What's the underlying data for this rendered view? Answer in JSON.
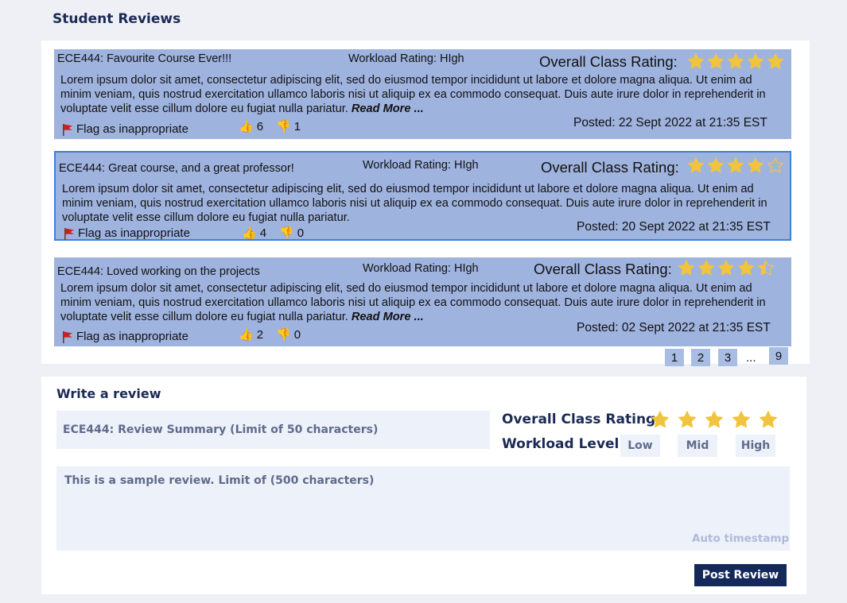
{
  "section_title": "Student Reviews",
  "colors": {
    "card_bg": "#9fb3df",
    "selected_border": "#3a82dc",
    "star": "#f0c43c",
    "heading": "#1b2a55",
    "button_bg": "#14285a"
  },
  "reviews": [
    {
      "title": "ECE444: Favourite Course Ever!!!",
      "workload": "Workload Rating: HIgh",
      "rating_label": "Overall Class Rating:",
      "rating": 5,
      "body": "Lorem ipsum dolor sit amet, consectetur adipiscing elit, sed do eiusmod tempor incididunt ut labore et dolore magna aliqua. Ut enim ad minim veniam, quis nostrud exercitation ullamco laboris nisi ut aliquip ex ea commodo consequat. Duis aute irure dolor in reprehenderit in voluptate velit esse cillum dolore eu fugiat nulla pariatur.",
      "read_more": "Read More ...",
      "flag_label": "Flag as inappropriate",
      "thumbs_up": "6",
      "thumbs_down": "1",
      "posted": "Posted: 22 Sept 2022 at 21:35 EST"
    },
    {
      "title": "ECE444: Great course, and a great professor!",
      "workload": "Workload Rating: HIgh",
      "rating_label": "Overall Class Rating:",
      "rating": 4,
      "body": "Lorem ipsum dolor sit amet, consectetur adipiscing elit, sed do eiusmod tempor incididunt ut labore et dolore magna aliqua. Ut enim ad minim veniam, quis nostrud exercitation ullamco laboris nisi ut aliquip ex ea commodo consequat. Duis aute irure dolor in reprehenderit in voluptate velit esse cillum dolore eu fugiat nulla pariatur.",
      "read_more": "",
      "flag_label": "Flag as inappropriate",
      "thumbs_up": "4",
      "thumbs_down": "0",
      "posted": "Posted: 20 Sept 2022 at 21:35 EST"
    },
    {
      "title": "ECE444: Loved working on the projects",
      "workload": "Workload Rating: HIgh",
      "rating_label": "Overall Class Rating:",
      "rating": 4.5,
      "body": "Lorem ipsum dolor sit amet, consectetur adipiscing elit, sed do eiusmod tempor incididunt ut labore et dolore magna aliqua. Ut enim ad minim veniam, quis nostrud exercitation ullamco laboris nisi ut aliquip ex ea commodo consequat. Duis aute irure dolor in reprehenderit in voluptate velit esse cillum dolore eu fugiat nulla pariatur.",
      "read_more": "Read More ...",
      "flag_label": "Flag as inappropriate",
      "thumbs_up": "2",
      "thumbs_down": "0",
      "posted": "Posted: 02 Sept 2022 at 21:35 EST"
    }
  ],
  "pagination": {
    "pages": [
      "1",
      "2",
      "3"
    ],
    "ellipsis": "...",
    "last": "9"
  },
  "write": {
    "title": "Write a review",
    "summary_placeholder": "ECE444: Review Summary (Limit of 50 characters)",
    "rating_label": "Overall Class Rating:",
    "workload_label": "Workload Level:",
    "levels": [
      "Low",
      "Mid",
      "High"
    ],
    "review_placeholder": "This is a sample review. Limit of (500 characters)",
    "auto_timestamp": "Auto timestamp",
    "post_button": "Post Review"
  }
}
